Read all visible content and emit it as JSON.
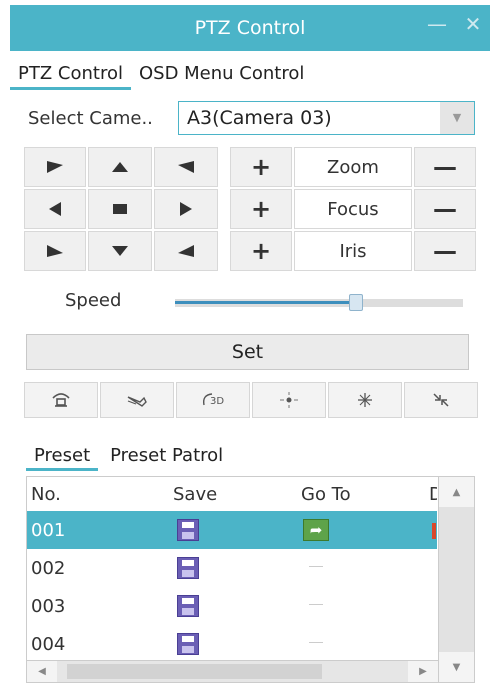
{
  "window": {
    "title": "PTZ Control",
    "minimize_glyph": "—",
    "close_glyph": "✕"
  },
  "tabs": [
    {
      "label": "PTZ Control",
      "active": true
    },
    {
      "label": "OSD Menu Control",
      "active": false
    }
  ],
  "camera": {
    "label": "Select Came..",
    "value": "A3(Camera 03)"
  },
  "lens": [
    {
      "label": "Zoom",
      "plus": "+",
      "minus": "—"
    },
    {
      "label": "Focus",
      "plus": "+",
      "minus": "—"
    },
    {
      "label": "Iris",
      "plus": "+",
      "minus": "—"
    }
  ],
  "speed": {
    "label": "Speed",
    "level_fraction": 0.63
  },
  "set_button": "Set",
  "function_icons": [
    "wiper-icon",
    "light-icon",
    "3d-positioning-icon",
    "light-spot-icon",
    "snowflake-icon",
    "minimize-arrows-icon"
  ],
  "function_icon_3d_text": "3D",
  "preset_tabs": [
    {
      "label": "Preset",
      "active": true
    },
    {
      "label": "Preset Patrol",
      "active": false
    }
  ],
  "preset_table": {
    "columns": [
      "No.",
      "Save",
      "Go To",
      "D"
    ],
    "rows": [
      {
        "no": "001",
        "selected": true,
        "goto": "arrow"
      },
      {
        "no": "002",
        "selected": false,
        "goto": "dash"
      },
      {
        "no": "003",
        "selected": false,
        "goto": "dash"
      },
      {
        "no": "004",
        "selected": false,
        "goto": "dash"
      }
    ]
  },
  "colors": {
    "accent": "#4bb4c8",
    "save_icon": "#6b5fb5",
    "goto_icon": "#5ea34a"
  }
}
